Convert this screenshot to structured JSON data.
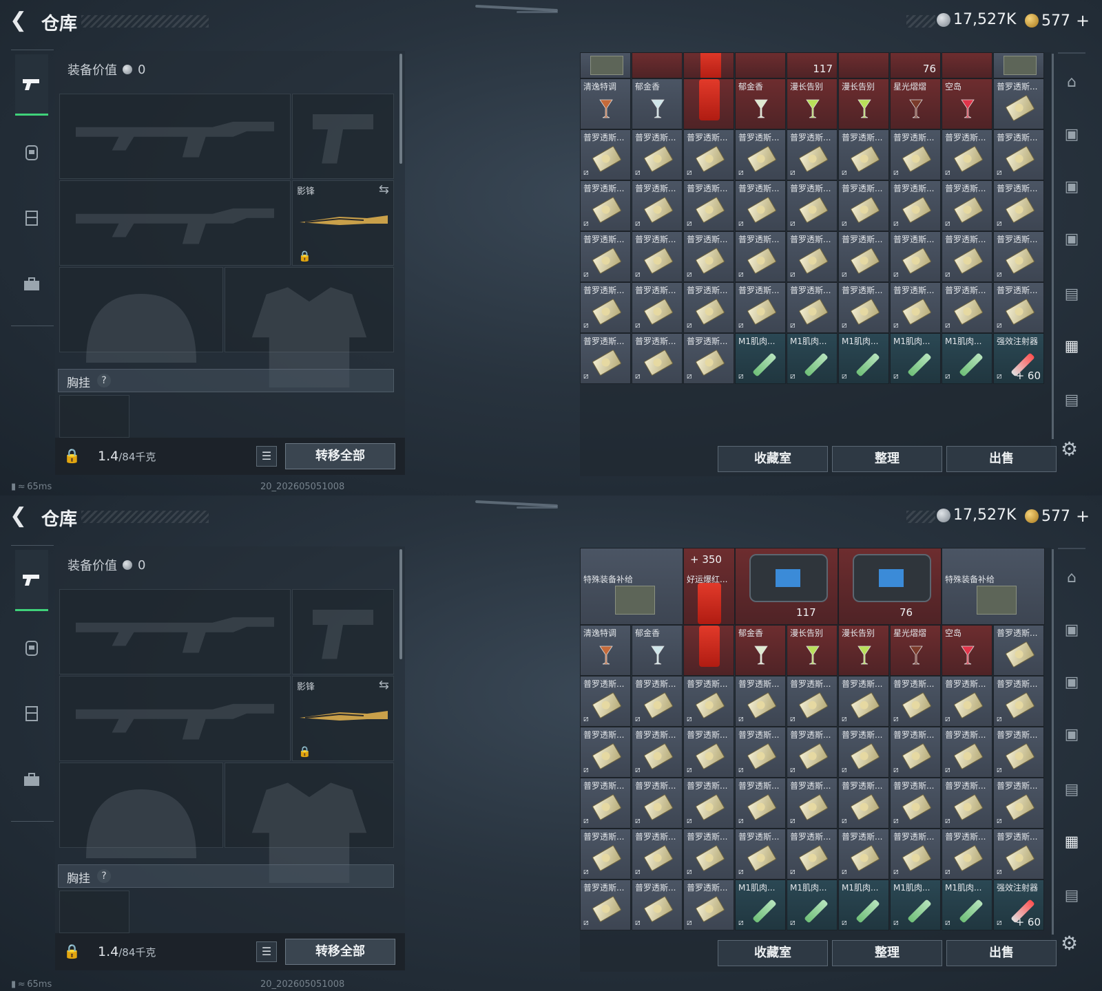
{
  "header": {
    "title": "仓库"
  },
  "currency": {
    "silver": "17,527K",
    "gold": "577",
    "gold_plus": "+"
  },
  "equipment": {
    "value_label": "装备价值",
    "value": "0",
    "knife_name": "影锋",
    "vest_label": "胸挂",
    "help": "?",
    "weight_current": "1.4",
    "weight_max": "/84千克",
    "transfer_all": "转移全部"
  },
  "status": {
    "ping": "65ms",
    "uid": "20_202605051008"
  },
  "actions": {
    "collection": "收藏室",
    "sort": "整理",
    "sell": "出售"
  },
  "stash_top": {
    "tag_117": "117",
    "tag_76": "76",
    "row_named": [
      "清逸特调",
      "郁金香",
      "",
      "郁金香",
      "漫长告别",
      "漫长告别",
      "星光熠熠",
      "空岛",
      "普罗透斯..."
    ],
    "row_ticket": "普罗透斯...",
    "row_last": [
      "普罗透斯...",
      "普罗透斯...",
      "普罗透斯...",
      "M1肌肉...",
      "M1肌肉...",
      "M1肌肉...",
      "M1肌肉...",
      "M1肌肉...",
      "强效注射器"
    ],
    "amount_last": "+ 60"
  },
  "stash_bottom": {
    "box1": "特殊装备补给",
    "box2": "特殊装备补给",
    "red_name": "好运爆红...",
    "amount_350": "+ 350",
    "tag_117": "117",
    "tag_76": "76",
    "row_named": [
      "清逸特调",
      "郁金香",
      "",
      "郁金香",
      "漫长告别",
      "漫长告别",
      "星光熠熠",
      "空岛",
      "普罗透斯..."
    ],
    "row_ticket": "普罗透斯...",
    "row_last": [
      "普罗透斯...",
      "普罗透斯...",
      "普罗透斯...",
      "M1肌肉...",
      "M1肌肉...",
      "M1肌肉...",
      "M1肌肉...",
      "M1肌肉...",
      "强效注射器"
    ],
    "amount_last": "+ 60"
  },
  "icons": {
    "back": "back-arrow-icon",
    "silver": "silver-coin-icon",
    "gold": "gold-coin-icon",
    "weapon": "pistol-icon",
    "backpack": "backpack-icon",
    "rig": "rig-icon",
    "case": "case-icon",
    "lock": "lock-icon",
    "list": "list-icon",
    "gear": "gear-icon"
  },
  "colors": {
    "accent": "#3fd27a",
    "red_cell": "#6d2d2f",
    "teal_cell": "#2b4854"
  }
}
